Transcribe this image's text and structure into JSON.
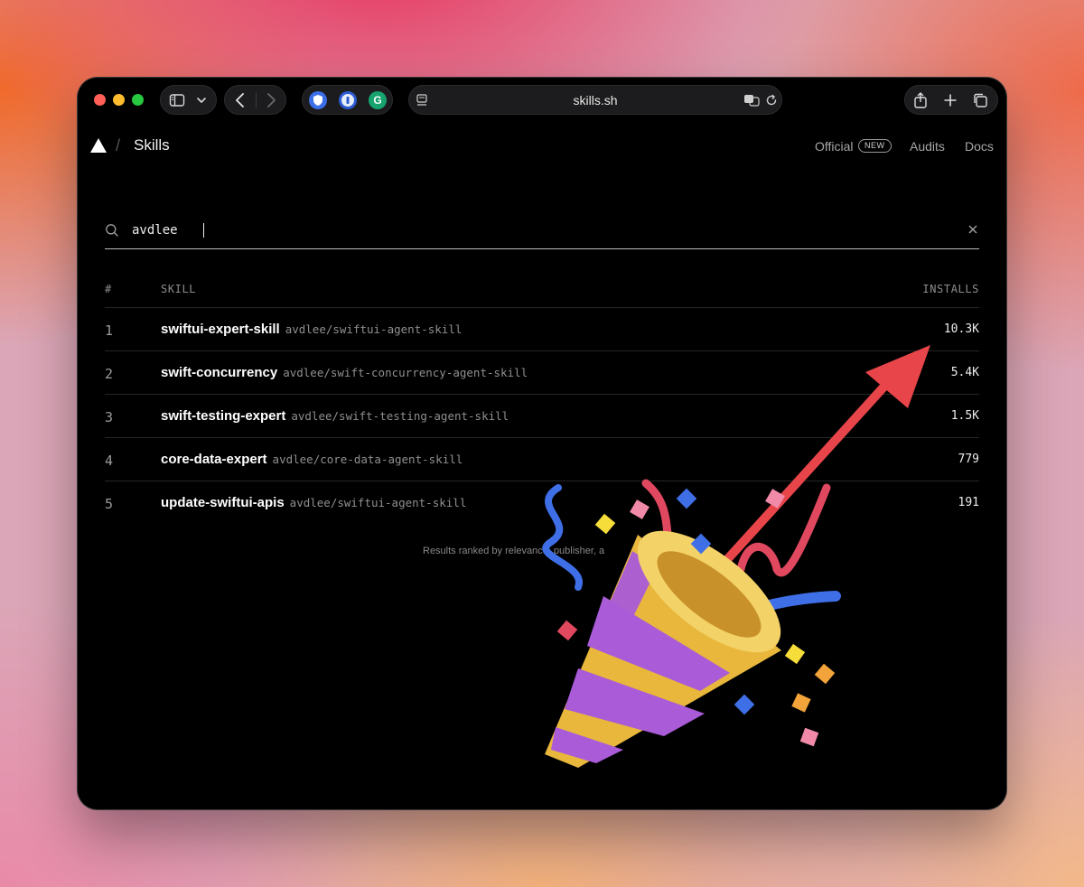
{
  "browser": {
    "url": "skills.sh",
    "colors": {
      "close": "#ff5f57",
      "minimize": "#febc2e",
      "zoom": "#28c840"
    },
    "extensions": [
      {
        "icon": "shield-icon"
      },
      {
        "icon": "password-manager-icon"
      },
      {
        "icon": "grammarly-icon",
        "letter": "G"
      }
    ]
  },
  "header": {
    "title": "Skills",
    "nav": {
      "official": "Official",
      "new_badge": "NEW",
      "audits": "Audits",
      "docs": "Docs"
    }
  },
  "search": {
    "value": "avdlee"
  },
  "table": {
    "columns": {
      "num": "#",
      "skill": "SKILL",
      "installs": "INSTALLS"
    },
    "rows": [
      {
        "num": "1",
        "name": "swiftui-expert-skill",
        "repo": "avdlee/swiftui-agent-skill",
        "installs": "10.3K"
      },
      {
        "num": "2",
        "name": "swift-concurrency",
        "repo": "avdlee/swift-concurrency-agent-skill",
        "installs": "5.4K"
      },
      {
        "num": "3",
        "name": "swift-testing-expert",
        "repo": "avdlee/swift-testing-agent-skill",
        "installs": "1.5K"
      },
      {
        "num": "4",
        "name": "core-data-expert",
        "repo": "avdlee/core-data-agent-skill",
        "installs": "779"
      },
      {
        "num": "5",
        "name": "update-swiftui-apis",
        "repo": "avdlee/swiftui-agent-skill",
        "installs": "191"
      }
    ]
  },
  "footnote": "Results ranked by relevance, publisher, a",
  "overlay": {
    "arrow_color": "#e8454a",
    "emoji": "party-popper-icon"
  }
}
